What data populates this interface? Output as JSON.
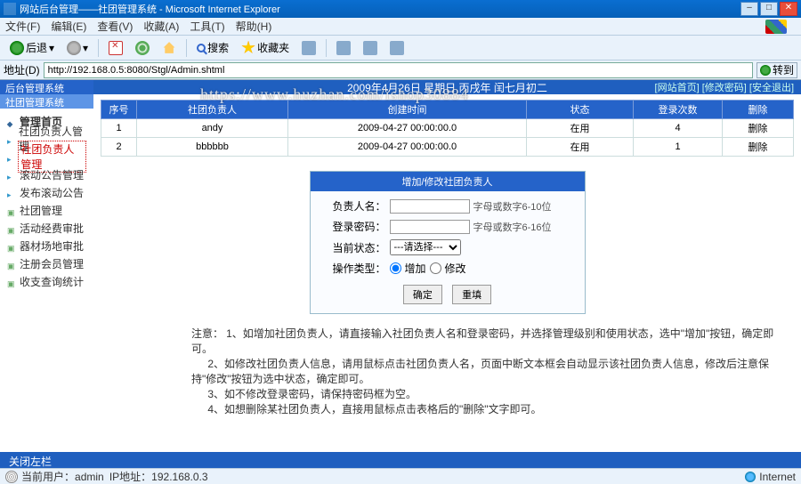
{
  "window": {
    "title": "网站后台管理——社团管理系统 - Microsoft Internet Explorer"
  },
  "menu": {
    "items": [
      "文件(F)",
      "编辑(E)",
      "查看(V)",
      "收藏(A)",
      "工具(T)",
      "帮助(H)"
    ]
  },
  "toolbar": {
    "back": "后退",
    "search": "搜索",
    "favorites": "收藏夹"
  },
  "addressbar": {
    "label": "地址(D)",
    "url": "http://192.168.0.5:8080/Stgl/Admin.shtml",
    "go": "转到"
  },
  "sidebar": {
    "title1": "后台管理系统",
    "title2": "社团管理系统",
    "items": [
      {
        "label": "管理首页",
        "kind": "head"
      },
      {
        "label": "社团负责人管理"
      },
      {
        "label": "社团负责人管理",
        "selected": true
      },
      {
        "label": "滚动公告管理"
      },
      {
        "label": "发布滚动公告"
      },
      {
        "label": "社团管理",
        "box": true
      },
      {
        "label": "活动经费审批",
        "box": true
      },
      {
        "label": "器材场地审批",
        "box": true
      },
      {
        "label": "注册会员管理",
        "box": true
      },
      {
        "label": "收支查询统计",
        "box": true
      }
    ]
  },
  "topbar": {
    "date": "2009年4月26日 星期日 丙戌年 闰七月初二",
    "links": "[网站首页] [修改密码] [安全退出]"
  },
  "watermark": "https://www.huzhan.com/ishop30884",
  "table": {
    "headers": [
      "序号",
      "社团负责人",
      "创建时间",
      "状态",
      "登录次数",
      "删除"
    ],
    "rows": [
      [
        "1",
        "andy",
        "2009-04-27 00:00:00.0",
        "在用",
        "4",
        "删除"
      ],
      [
        "2",
        "bbbbbb",
        "2009-04-27 00:00:00.0",
        "在用",
        "1",
        "删除"
      ]
    ]
  },
  "form": {
    "title": "增加/修改社团负责人",
    "fields": {
      "name_label": "负责人名：",
      "name_hint": "字母或数字6-10位",
      "pwd_label": "登录密码：",
      "pwd_hint": "字母或数字6-16位",
      "status_label": "当前状态：",
      "status_placeholder": "---请选择---",
      "optype_label": "操作类型：",
      "opt_add": "增加",
      "opt_mod": "修改"
    },
    "buttons": {
      "ok": "确定",
      "reset": "重填"
    }
  },
  "notes": {
    "head": "注意：",
    "l1": "1、如增加社团负责人，请直接输入社团负责人名和登录密码，并选择管理级别和使用状态，选中\"增加\"按钮，确定即可。",
    "l2": "2、如修改社团负责人信息，请用鼠标点击社团负责人名，页面中断文本框会自动显示该社团负责人信息，修改后注意保持\"修改\"按钮为选中状态，确定即可。",
    "l3": "3、如不修改登录密码，请保持密码框为空。",
    "l4": "4、如想删除某社团负责人，直接用鼠标点击表格后的\"删除\"文字即可。"
  },
  "bottombar": {
    "text": "关闭左栏"
  },
  "statusbar": {
    "user_label": "当前用户：",
    "user": "admin",
    "ip_label": "IP地址：",
    "ip": "192.168.0.3",
    "zone": "Internet"
  }
}
